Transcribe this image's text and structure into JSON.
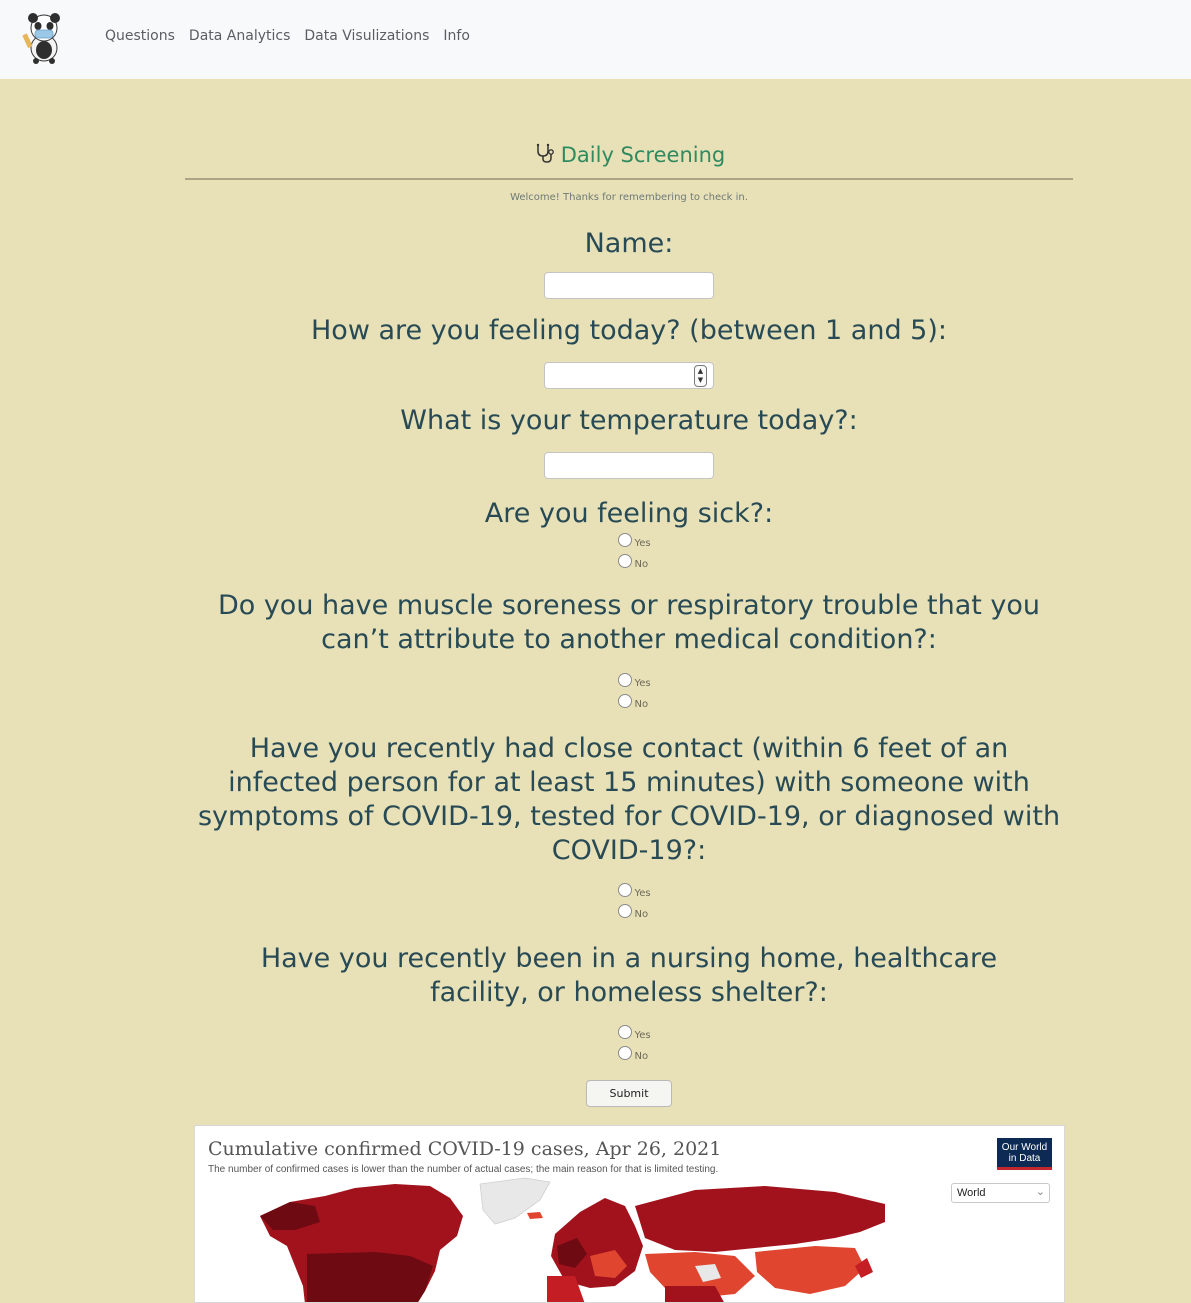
{
  "nav": {
    "links": [
      "Questions",
      "Data Analytics",
      "Data Visulizations",
      "Info"
    ]
  },
  "form": {
    "title": "Daily Screening",
    "welcome": "Welcome! Thanks for remembering to check in.",
    "name_label": "Name:",
    "feeling_label": "How are you feeling today? (between 1 and 5):",
    "temperature_label": "What is your temperature today?:",
    "sick_label": "Are you feeling sick?:",
    "soreness_label": "Do you have muscle soreness or respiratory trouble that you can’t attribute to another medical condition?:",
    "contact_label": "Have you recently had close contact (within 6 feet of an infected person for at least 15 minutes) with someone with symptoms of COVID-19, tested for COVID-19, or diagnosed with COVID-19?:",
    "facility_label": "Have you recently been in a nursing home, healthcare facility, or homeless shelter?:",
    "yes": "Yes",
    "no": "No",
    "submit": "Submit"
  },
  "map": {
    "title": "Cumulative confirmed COVID-19 cases, Apr 26, 2021",
    "subtitle": "The number of confirmed cases is lower than the number of actual cases; the main reason for that is limited testing.",
    "badge_line1": "Our World",
    "badge_line2": "in Data",
    "region": "World",
    "colors": {
      "dark": "#6e0a12",
      "mid": "#a1121d",
      "light": "#e0452f",
      "none": "#e8e8e8"
    }
  },
  "colors": {
    "background": "#e8e1b8",
    "title": "#2f8a5f",
    "label": "#284a55"
  },
  "icons": {
    "logo": "panda-logo-icon",
    "title": "stethoscope-icon"
  }
}
